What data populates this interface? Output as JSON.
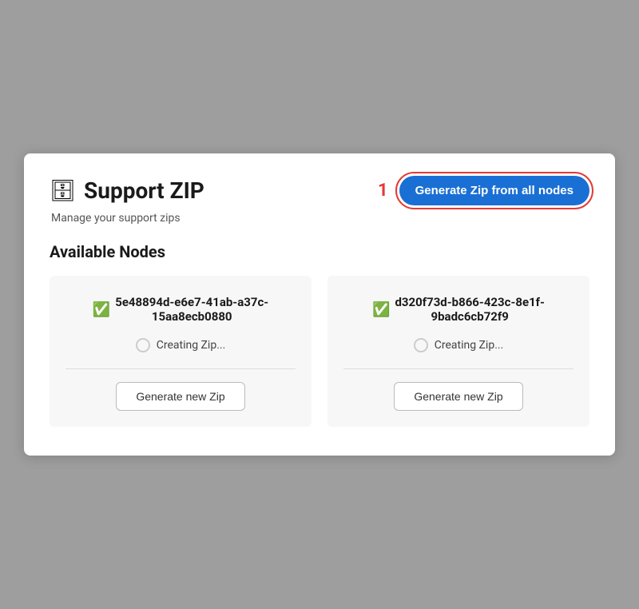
{
  "header": {
    "icon": "🗄",
    "title": "Support ZIP",
    "badge": "1",
    "generate_all_label": "Generate Zip from all nodes"
  },
  "subtitle": "Manage your support zips",
  "section_title": "Available Nodes",
  "nodes": [
    {
      "id": "node-1",
      "name_line1": "5e48894d-e6e7-41ab-a37c-",
      "name_line2": "15aa8ecb0880",
      "status": "Creating Zip...",
      "generate_label": "Generate new Zip"
    },
    {
      "id": "node-2",
      "name_line1": "d320f73d-b866-423c-8e1f-",
      "name_line2": "9badc6cb72f9",
      "status": "Creating Zip...",
      "generate_label": "Generate new Zip"
    }
  ]
}
